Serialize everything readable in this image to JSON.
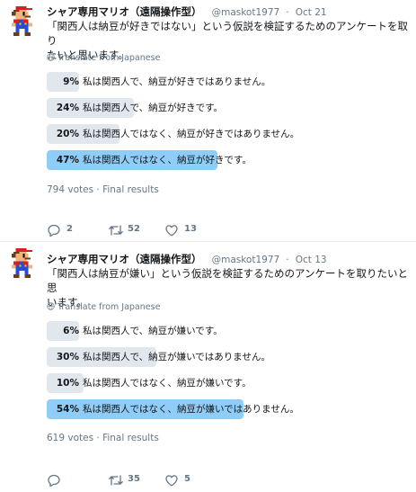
{
  "tweets": [
    {
      "author": "シャア専用マリオ（遠隔操作型）",
      "handle": "@maskot1977",
      "sep": "·",
      "date": "Oct 21",
      "text_line1": "「関西人は納豆が好きではない」という仮説を検証するためのアンケートを取り",
      "text_line2": "たいと思います。",
      "translate": "Translate from Japanese",
      "poll": [
        {
          "pct": "9%",
          "value": 9,
          "label": "私は関西人で、納豆が好きではありません。"
        },
        {
          "pct": "24%",
          "value": 24,
          "label": "私は関西人で、納豆が好きです。"
        },
        {
          "pct": "20%",
          "value": 20,
          "label": "私は関西人ではなく、納豆が好きではありません。"
        },
        {
          "pct": "47%",
          "value": 47,
          "label": "私は関西人ではなく、納豆が好きです。"
        }
      ],
      "votes": "794 votes · Final results",
      "replies": "2",
      "retweets": "52",
      "likes": "13"
    },
    {
      "author": "シャア専用マリオ（遠隔操作型）",
      "handle": "@maskot1977",
      "sep": "·",
      "date": "Oct 13",
      "text_line1": "「関西人は納豆が嫌い」という仮説を検証するためのアンケートを取りたいと思",
      "text_line2": "います。",
      "translate": "Translate from Japanese",
      "poll": [
        {
          "pct": "6%",
          "value": 6,
          "label": "私は関西人で、納豆が嫌いです。"
        },
        {
          "pct": "30%",
          "value": 30,
          "label": "私は関西人で、納豆が嫌いではありません。"
        },
        {
          "pct": "10%",
          "value": 10,
          "label": "私は関西人ではなく、納豆が嫌いです。"
        },
        {
          "pct": "54%",
          "value": 54,
          "label": "私は関西人ではなく、納豆が嫌いではありません。"
        }
      ],
      "votes": "619 votes · Final results",
      "replies": "",
      "retweets": "35",
      "likes": "5"
    }
  ],
  "icons": [
    "avatar-mario",
    "globe-icon",
    "reply-icon",
    "retweet-icon",
    "like-icon"
  ],
  "colors": {
    "winner_bar": "#8ecdf8",
    "bar": "#e1e8ed",
    "secondary_text": "#657786",
    "divider": "#e6ecf0"
  }
}
